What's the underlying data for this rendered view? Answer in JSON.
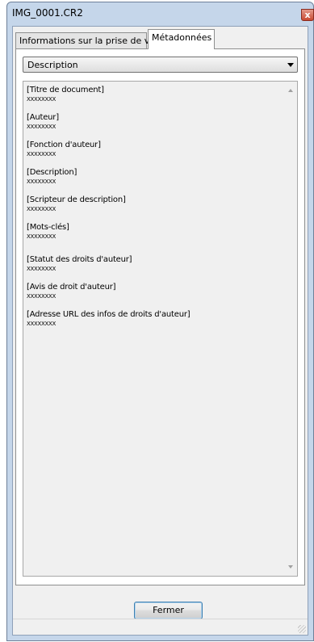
{
  "window": {
    "title": "IMG_0001.CR2",
    "close_glyph": "x"
  },
  "tabs": [
    {
      "label": "Informations sur la prise de vue",
      "selected": false
    },
    {
      "label": "Métadonnées",
      "selected": true
    }
  ],
  "dropdown": {
    "selected": "Description"
  },
  "fields": [
    {
      "label": "[Titre de document]",
      "value": "XXXXXXXX"
    },
    {
      "label": "[Auteur]",
      "value": "XXXXXXXX"
    },
    {
      "label": "[Fonction d'auteur]",
      "value": "XXXXXXXX"
    },
    {
      "label": "[Description]",
      "value": "XXXXXXXX"
    },
    {
      "label": "[Scripteur de description]",
      "value": "XXXXXXXX"
    },
    {
      "label": "[Mots-clés]",
      "value": "XXXXXXXX"
    },
    {
      "label": "[Statut des droits d'auteur]",
      "value": "XXXXXXXX"
    },
    {
      "label": "[Avis de droit d'auteur]",
      "value": "XXXXXXXX"
    },
    {
      "label": "[Adresse URL des infos de droits d'auteur]",
      "value": "XXXXXXXX"
    }
  ],
  "buttons": {
    "close_label": "Fermer"
  },
  "icons": {
    "close": "close-icon",
    "dropdown": "chevron-down-icon",
    "scroll_up": "scroll-up-arrow-icon",
    "scroll_down": "scroll-down-arrow-icon",
    "resize": "resize-grip-icon"
  },
  "colors": {
    "frame": "#c5d6ea",
    "client": "#f0f0f0",
    "close_button": "#c94a33",
    "button_border": "#3c7fb1"
  }
}
